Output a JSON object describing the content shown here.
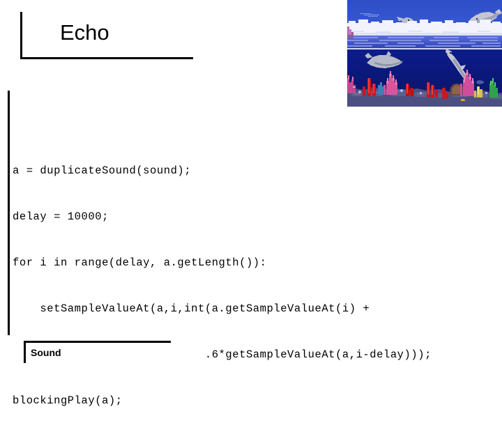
{
  "slide": {
    "title": "Echo",
    "footer_label": "Sound",
    "background_color": "#ffffff",
    "rule_color": "#000000"
  },
  "code": {
    "language": "python",
    "lines": [
      "a = duplicateSound(sound);",
      "delay = 10000;",
      "for i in range(delay, a.getLength()):",
      "    setSampleValueAt(a,i,int(a.getSampleValueAt(i) +",
      "                            .6*getSampleValueAt(a,i-delay)));",
      "blockingPlay(a);"
    ],
    "text_color": "#000000"
  },
  "picture": {
    "name": "dolphin-coral-reef-photo",
    "alt": "Pixel-art underwater scene: dolphins leaping over ocean waves above, two dolphins swimming underwater below, colorful coral reef on the sea floor",
    "colors": {
      "sky": "#3252cb",
      "foam": "#eef0fb",
      "surface_water": "#4a5fd3",
      "deep_water": "#0b1a7e",
      "reef_rock": "#4a4a77",
      "coral_red": "#d01820",
      "coral_pink": "#e060a8",
      "coral_green": "#2aa24a",
      "coral_yellow": "#e8d060",
      "dolphin_body": "#b9bcc9"
    }
  }
}
